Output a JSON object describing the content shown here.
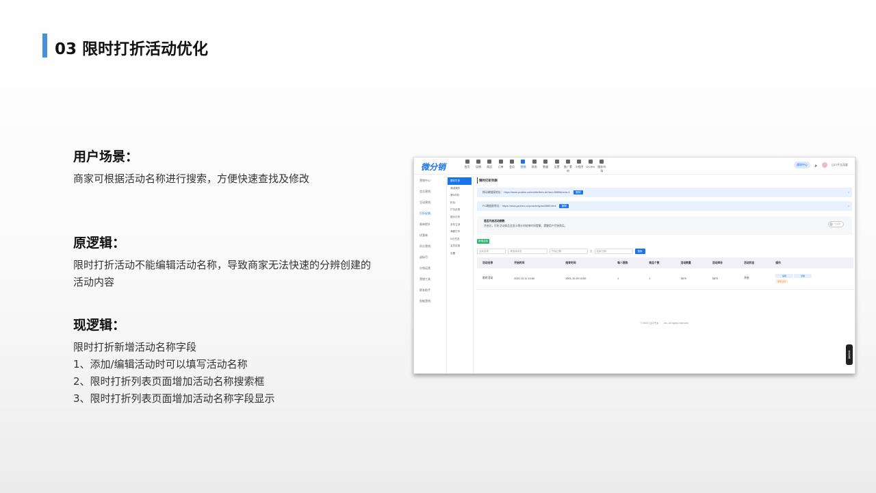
{
  "slide": {
    "title": "03 限时打折活动优化",
    "accent_color": "#4a90d9"
  },
  "sections": {
    "scene": {
      "heading": "用户场景：",
      "lines": [
        "商家可根据活动名称进行搜索，方便快速查找及修改"
      ]
    },
    "old": {
      "heading": "原逻辑：",
      "lines": [
        "限时打折活动不能编辑活动名称，导致商家无法快速的分辨创建的活动内容"
      ]
    },
    "new": {
      "heading": "现逻辑：",
      "lines": [
        "限时打折新增活动名称字段",
        "1、添加/编辑活动时可以填写活动名称",
        "2、限时打折列表页面增加活动名称搜索框",
        "3、限时打折列表页面增加活动名称字段显示"
      ]
    }
  },
  "screenshot": {
    "logo": "微分销",
    "nav": [
      "首页",
      "店铺",
      "商品",
      "订单",
      "会员",
      "营销",
      "财务",
      "数据",
      "设置",
      "推广素材",
      "小程序",
      "DCRM",
      "服务市场"
    ],
    "nav_active": 5,
    "top_right": {
      "pill": "通知中心",
      "user": "山口不太深度"
    },
    "side1": [
      "营销中心",
      "会员营销",
      "互动营销",
      "打折促销",
      "限单提升",
      "优惠券",
      "积分营销",
      "虚拟币",
      "分销运营",
      "营销工具",
      "群发助手",
      "智能营销"
    ],
    "side1_active": 3,
    "side2": [
      "限时打折",
      "满减满折",
      "第N件折",
      "折扣",
      "打包优惠",
      "限价打折",
      "多件立减",
      "满额打折",
      "N元任选",
      "会员优惠",
      "设置"
    ],
    "side2_active": 0,
    "page_title": "限时打折列表",
    "notices": [
      {
        "text": "移动端链接地址： https://www.yzuben.co/mobile/item.do?act=3889&mms=1",
        "btn": "复制"
      },
      {
        "text": "PC端链接地址： https://www.yzuben.co/pc/activity/act3889.html",
        "btn": "复制"
      }
    ],
    "switch": {
      "title": "是否开启活动倒数",
      "desc": "开启后，打折活动商品会显示倒计时结束时间提醒，提醒用户尽快购买。",
      "toggle": "已关闭"
    },
    "add_label": "新增活动",
    "filters": {
      "name": "活动名称",
      "status": "请选择状态",
      "start": "开始日期",
      "to": "至",
      "end": "结束日期",
      "search": "搜索"
    },
    "table": {
      "headers": [
        "活动名称",
        "开始时间",
        "结束时间",
        "每人限购",
        "商品个数",
        "活动数量",
        "活动库存",
        "活动状态",
        "操作"
      ],
      "rows": [
        {
          "cells": [
            "限时活动",
            "2021-10-11 13:50",
            "2021-10-20 13:50",
            "1",
            "1",
            "3870",
            "3870",
            "开启"
          ],
          "ops": [
            "编辑",
            "复制",
            "结束活动"
          ]
        }
      ]
    },
    "footer": "© 2021 山口不太 · · , Inc. All rights reserved.",
    "float_btn": "联系客服"
  }
}
